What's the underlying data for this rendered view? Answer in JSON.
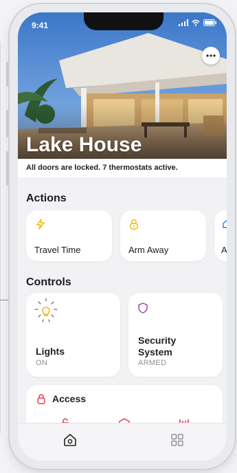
{
  "status_bar": {
    "time": "9:41"
  },
  "hero": {
    "title": "Lake House",
    "subtitle": "All doors are locked. 7 thermostats active."
  },
  "actions": {
    "title": "Actions",
    "items": [
      {
        "label": "Travel Time",
        "icon": "lightning-icon",
        "color": "#f5b400"
      },
      {
        "label": "Arm Away",
        "icon": "lock-icon",
        "color": "#f5b400"
      },
      {
        "label": "A",
        "icon": "home-icon",
        "color": "#2a7de1"
      }
    ]
  },
  "controls": {
    "title": "Controls",
    "items": [
      {
        "title": "Lights",
        "status": "ON",
        "icon": "lightbulb-icon",
        "color": "#f5b400"
      },
      {
        "title_line1": "Security",
        "title_line2": "System",
        "status": "ARMED",
        "icon": "shield-icon",
        "color": "#8a3fa6"
      }
    ]
  },
  "access": {
    "title": "Access",
    "icon": "lock-icon",
    "color": "#e53950",
    "items": [
      "unlock-icon",
      "garage-icon",
      "gate-icon"
    ]
  },
  "tabbar": {
    "items": [
      "home-tab-icon",
      "grid-tab-icon"
    ]
  }
}
